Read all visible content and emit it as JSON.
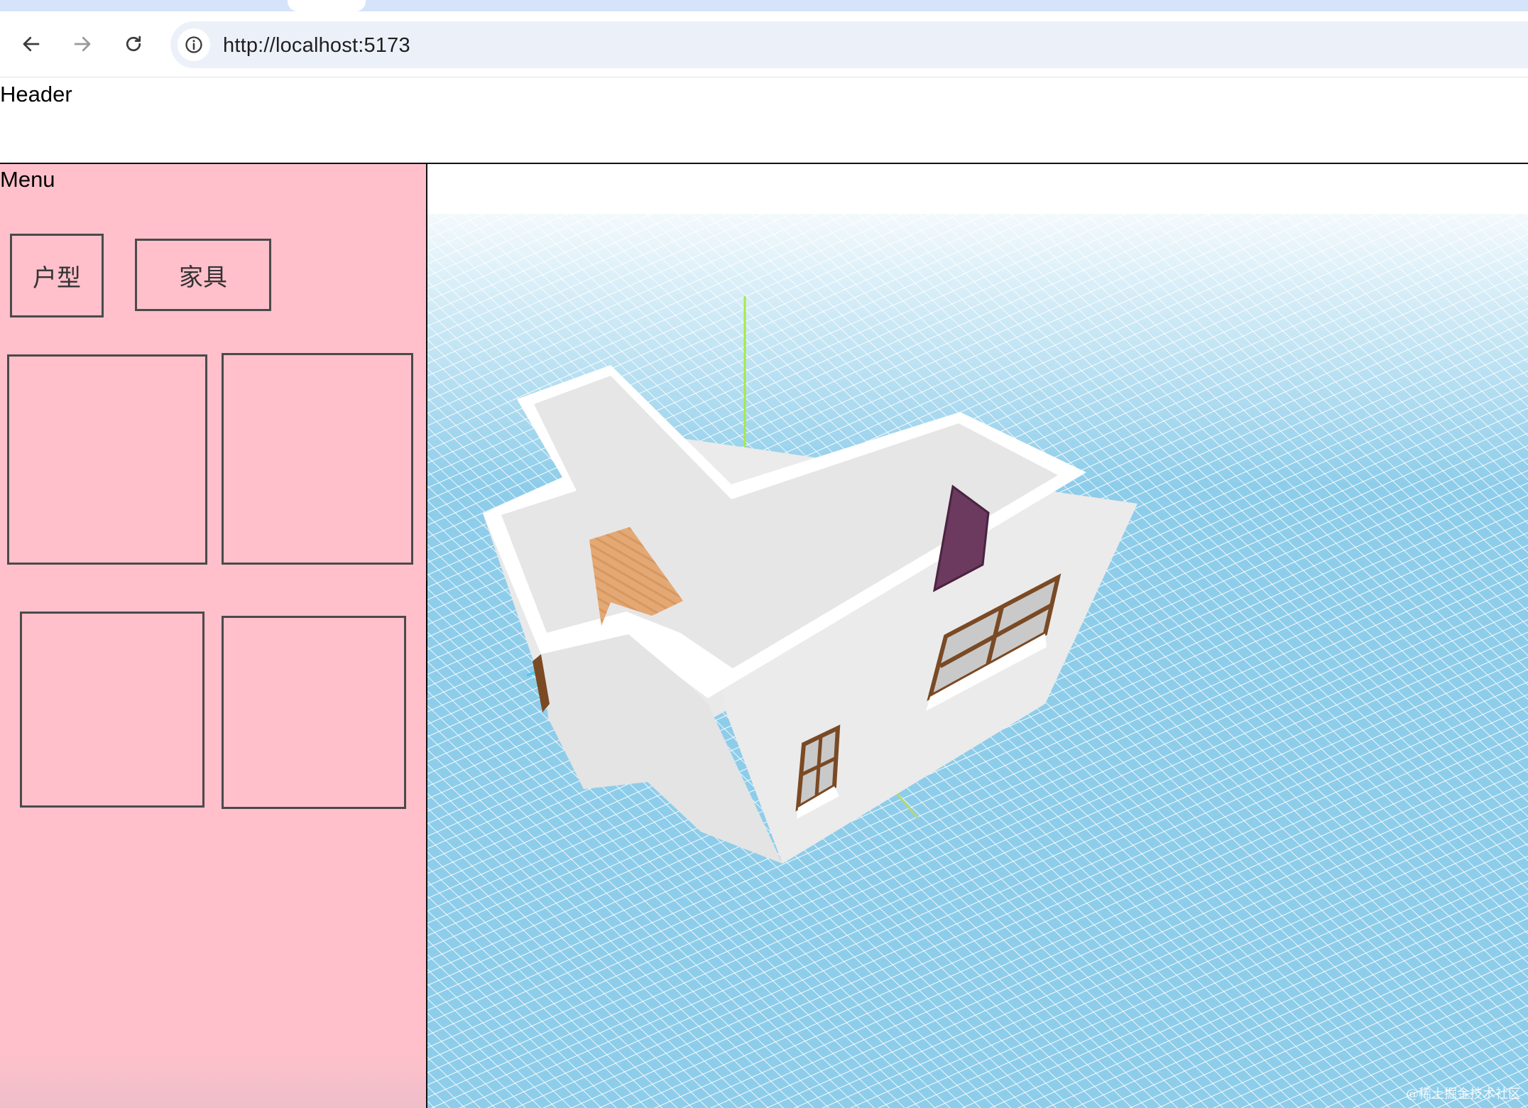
{
  "browser": {
    "url": "http://localhost:5173",
    "icons": {
      "back": "arrow-left-icon",
      "forward": "arrow-right-icon",
      "reload": "reload-icon",
      "site_info": "info-icon"
    }
  },
  "header": {
    "title": "Header"
  },
  "menu": {
    "title": "Menu",
    "tabs": [
      {
        "label": "户型"
      },
      {
        "label": "家具"
      }
    ],
    "background_color": "#ffc0cb"
  },
  "viewport": {
    "watermark": "@稀土掘金技术社区",
    "floor_color": "#8ecdea",
    "wall_color": "#e6e6e6",
    "door_color": "#6b3a5e",
    "window_frame_color": "#7a4a25"
  }
}
